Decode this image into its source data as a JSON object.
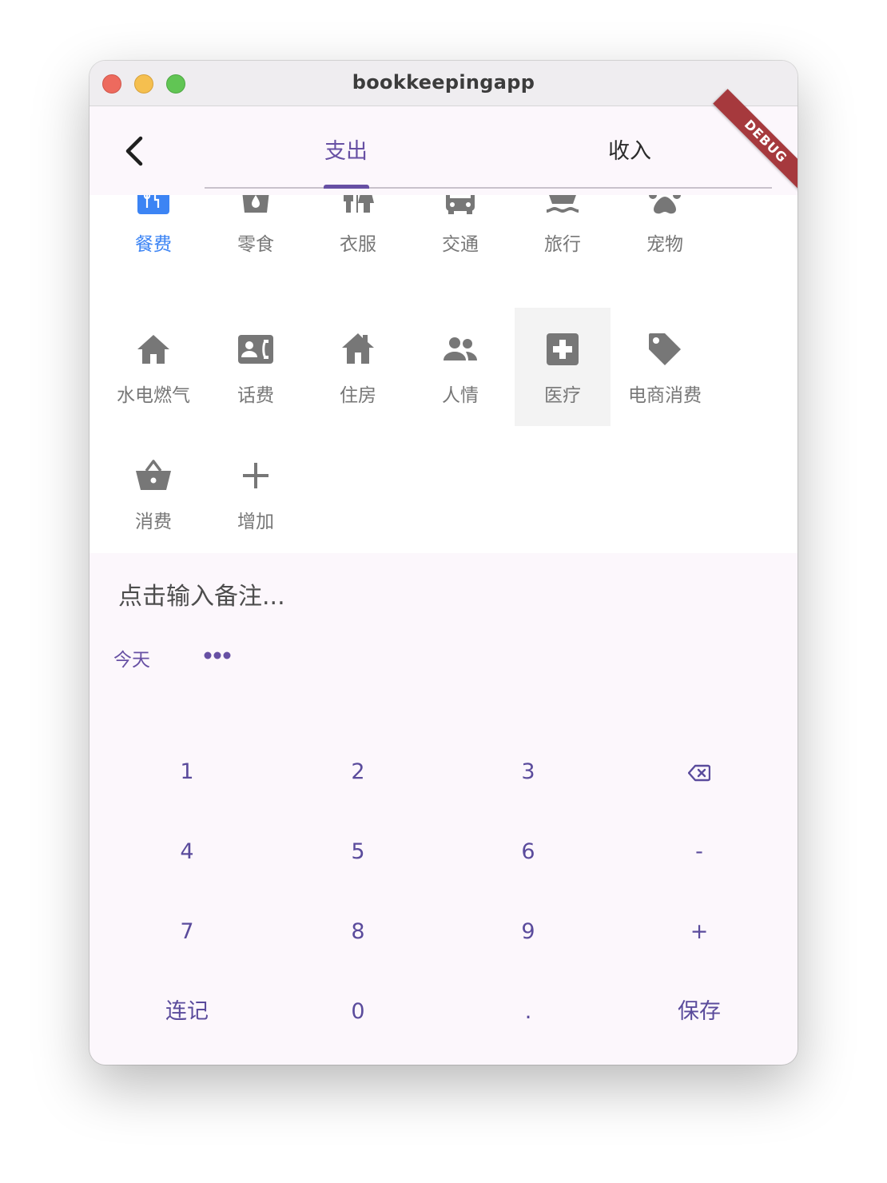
{
  "window": {
    "title": "bookkeepingapp"
  },
  "debug_banner": "DEBUG",
  "tabs": [
    {
      "label": "支出",
      "selected": true
    },
    {
      "label": "收入",
      "selected": false
    }
  ],
  "categories": [
    {
      "label": "餐费",
      "icon": "restaurant-icon",
      "selected": true
    },
    {
      "label": "零食",
      "icon": "snack-icon"
    },
    {
      "label": "衣服",
      "icon": "wc-icon"
    },
    {
      "label": "交通",
      "icon": "bus-icon"
    },
    {
      "label": "旅行",
      "icon": "ferry-icon"
    },
    {
      "label": "宠物",
      "icon": "paw-icon"
    },
    {
      "label": "水电燃气",
      "icon": "home-icon"
    },
    {
      "label": "话费",
      "icon": "phone-contact-icon"
    },
    {
      "label": "住房",
      "icon": "house-icon"
    },
    {
      "label": "人情",
      "icon": "people-icon"
    },
    {
      "label": "医疗",
      "icon": "medical-icon",
      "highlighted": true
    },
    {
      "label": "电商消费",
      "icon": "tag-icon"
    },
    {
      "label": "消费",
      "icon": "basket-icon"
    },
    {
      "label": "增加",
      "icon": "plus-icon"
    }
  ],
  "note": {
    "placeholder": "点击输入备注..."
  },
  "date_button": "今天",
  "keypad": {
    "k1": "1",
    "k2": "2",
    "k3": "3",
    "k4": "4",
    "k5": "5",
    "k6": "6",
    "minus": "-",
    "k7": "7",
    "k8": "8",
    "k9": "9",
    "plus": "+",
    "continuous": "连记",
    "k0": "0",
    "dot": ".",
    "save": "保存"
  },
  "colors": {
    "accent": "#6750a4",
    "selected_category": "#3c84f4",
    "icon_gray": "#777777",
    "debug": "#a6393d"
  }
}
